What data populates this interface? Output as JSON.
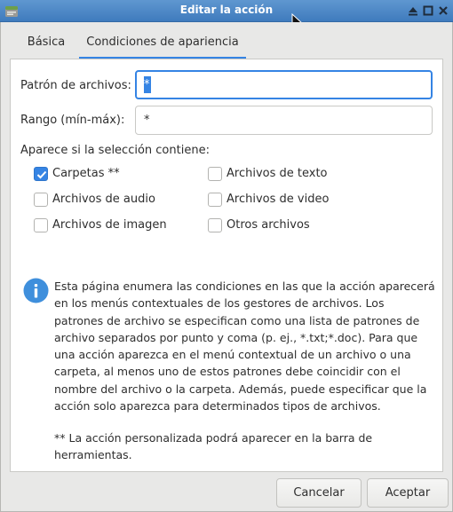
{
  "window": {
    "title": "Editar la acción"
  },
  "tabs": [
    {
      "label": "Básica",
      "active": false
    },
    {
      "label": "Condiciones de apariencia",
      "active": true
    }
  ],
  "form": {
    "pattern_label": "Patrón de archivos:",
    "pattern_value": "*",
    "range_label": "Rango (mín-máx):",
    "range_value": "*",
    "selection_label": "Aparece si la selección contiene:"
  },
  "checkboxes": [
    {
      "label": "Carpetas **",
      "checked": true
    },
    {
      "label": "Archivos de texto",
      "checked": false
    },
    {
      "label": "Archivos de audio",
      "checked": false
    },
    {
      "label": "Archivos de video",
      "checked": false
    },
    {
      "label": "Archivos de imagen",
      "checked": false
    },
    {
      "label": "Otros archivos",
      "checked": false
    }
  ],
  "info": {
    "icon": "info-icon",
    "text": "Esta página enumera las condiciones en las que la acción aparecerá en los menús contextuales de los gestores de archivos. Los patrones de archivo se especifican como una lista de patrones de archivo separados por punto y coma (p. ej., *.txt;*.doc). Para que una acción aparezca en el menú contextual de un archivo o una carpeta, al menos uno de estos patrones debe coincidir con el nombre del archivo o la carpeta. Además, puede especificar que la acción solo aparezca para determinados tipos de archivos.",
    "note": "** La acción personalizada podrá aparecer en la barra de herramientas."
  },
  "buttons": {
    "cancel": "Cancelar",
    "accept": "Aceptar"
  },
  "colors": {
    "accent": "#3584e4",
    "titlebar": "#4a87c6"
  }
}
